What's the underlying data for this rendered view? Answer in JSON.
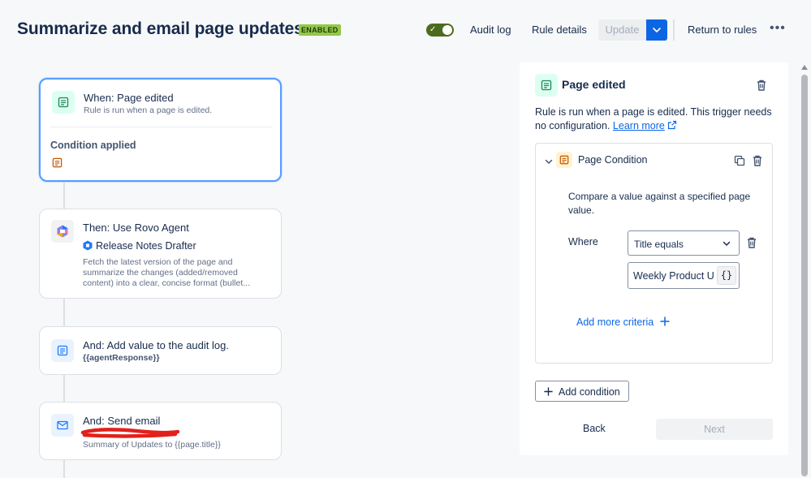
{
  "header": {
    "title": "Summarize and email page updates",
    "status_badge": "ENABLED",
    "audit_log": "Audit log",
    "rule_details": "Rule details",
    "update": "Update",
    "return_to_rules": "Return to rules",
    "more": "•••"
  },
  "flow": {
    "trigger": {
      "title": "When: Page edited",
      "subtitle": "Rule is run when a page is edited.",
      "condition_label": "Condition applied"
    },
    "agent": {
      "title": "Then: Use Rovo Agent",
      "agent_name": "Release Notes Drafter",
      "description": "Fetch the latest version of the page and summarize the changes (added/removed content) into a clear, concise format (bullet..."
    },
    "audit": {
      "title": "And: Add value to the audit log.",
      "value": "{{agentResponse}}"
    },
    "email": {
      "title": "And: Send email",
      "subtitle": "Summary of Updates to {{page.title}}"
    }
  },
  "panel": {
    "title": "Page edited",
    "description": "Rule is run when a page is edited. This trigger needs no configuration.",
    "learn_more": "Learn more",
    "condition": {
      "title": "Page Condition",
      "description": "Compare a value against a specified page value.",
      "where_label": "Where",
      "selected_field": "Title equals",
      "value": "Weekly Product Updates",
      "smart_value_button": "{}",
      "add_criteria": "Add more criteria"
    },
    "add_condition": "Add condition",
    "back": "Back",
    "next": "Next"
  },
  "colors": {
    "accent_blue": "#0c66e4",
    "enabled_green": "#94c748",
    "toggle_green": "#4c6b1f",
    "annotation_red": "#e2201c"
  }
}
